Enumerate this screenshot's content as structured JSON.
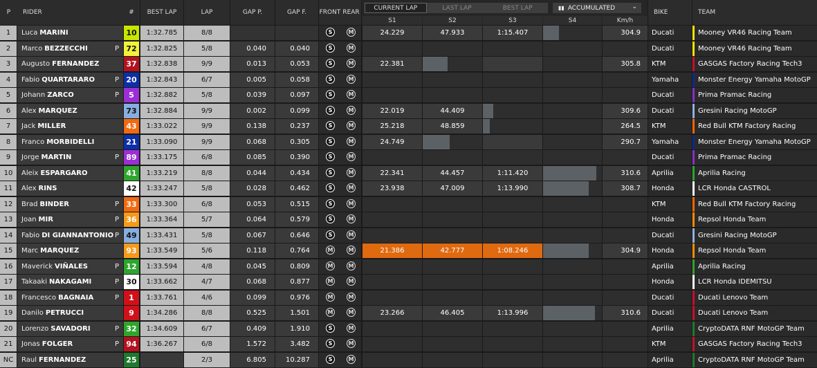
{
  "headers": {
    "p": "P",
    "rider": "RIDER",
    "num": "#",
    "best_lap": "BEST LAP",
    "lap": "LAP",
    "gap_p": "GAP P.",
    "gap_f": "GAP F.",
    "front": "FRONT",
    "rear": "REAR",
    "bike": "BIKE",
    "team": "TEAM"
  },
  "tabs": [
    "CURRENT LAP",
    "LAST LAP",
    "BEST LAP"
  ],
  "dropdown": {
    "value": "ACCUMULATED",
    "icon": "bar-chart-icon"
  },
  "sector_headers": [
    "S1",
    "S2",
    "S3",
    "S4",
    "Km/h"
  ],
  "colors": {
    "ducati_vr46": "#f2e500",
    "gasgas": "#c8102e",
    "yamaha": "#0a2a8c",
    "pramac": "#8b2fc9",
    "gresini": "#8fb4dc",
    "ktm": "#ff6600",
    "aprilia": "#2ea62e",
    "lcr": "#ffffff",
    "repsol": "#ff8c00",
    "lenovo": "#c8102e",
    "rnf": "#1f7a2e"
  },
  "riders": [
    {
      "pos": "1",
      "first": "Luca",
      "last": "MARINI",
      "pen": "",
      "num": "10",
      "num_bg": "#c8e600",
      "num_fg": "#111",
      "best": "1:32.785",
      "laps": "8/8",
      "gap_p": "",
      "gap_f": "",
      "front": "S",
      "rear": "M",
      "s1": "24.229",
      "s2": "47.933",
      "s3": "1:15.407",
      "s4_fill": 0.27,
      "s1o": false,
      "kmh": "304.9",
      "bike": "Ducati",
      "team": "Mooney VR46 Racing Team",
      "tcolor": "#f2e500"
    },
    {
      "pos": "2",
      "first": "Marco",
      "last": "BEZZECCHI",
      "pen": "P",
      "num": "72",
      "num_bg": "#f2f23a",
      "num_fg": "#111",
      "best": "1:32.825",
      "laps": "5/8",
      "gap_p": "0.040",
      "gap_f": "0.040",
      "front": "S",
      "rear": "M",
      "s1": "",
      "s2": "",
      "s3": "",
      "s4_fill": 0,
      "kmh": "",
      "bike": "Ducati",
      "team": "Mooney VR46 Racing Team",
      "tcolor": "#f2e500"
    },
    {
      "pos": "3",
      "first": "Augusto",
      "last": "FERNANDEZ",
      "pen": "",
      "num": "37",
      "num_bg": "#b3121f",
      "num_fg": "#fff",
      "best": "1:32.838",
      "laps": "9/9",
      "gap_p": "0.013",
      "gap_f": "0.053",
      "front": "S",
      "rear": "M",
      "s1": "22.381",
      "s2": "",
      "s3": "",
      "s2_fill": 0.42,
      "s4_fill": 0,
      "kmh": "305.8",
      "bike": "KTM",
      "team": "GASGAS Factory Racing Tech3",
      "tcolor": "#c8102e"
    },
    {
      "pos": "4",
      "first": "Fabio",
      "last": "QUARTARARO",
      "pen": "P",
      "num": "20",
      "num_bg": "#0d2fa8",
      "num_fg": "#fff",
      "best": "1:32.843",
      "laps": "6/7",
      "gap_p": "0.005",
      "gap_f": "0.058",
      "front": "S",
      "rear": "M",
      "s1": "",
      "s2": "",
      "s3": "",
      "s4_fill": 0,
      "kmh": "",
      "bike": "Yamaha",
      "team": "Monster Energy Yamaha MotoGP",
      "tcolor": "#0a2a8c"
    },
    {
      "pos": "5",
      "first": "Johann",
      "last": "ZARCO",
      "pen": "P",
      "num": "5",
      "num_bg": "#9b2fd6",
      "num_fg": "#fff",
      "best": "1:32.882",
      "laps": "5/8",
      "gap_p": "0.039",
      "gap_f": "0.097",
      "front": "S",
      "rear": "M",
      "s1": "",
      "s2": "",
      "s3": "",
      "s4_fill": 0,
      "kmh": "",
      "bike": "Ducati",
      "team": "Prima Pramac Racing",
      "tcolor": "#8b2fc9"
    },
    {
      "pos": "6",
      "first": "Alex",
      "last": "MARQUEZ",
      "pen": "",
      "num": "73",
      "num_bg": "#86aee0",
      "num_fg": "#111",
      "best": "1:32.884",
      "laps": "9/9",
      "gap_p": "0.002",
      "gap_f": "0.099",
      "front": "S",
      "rear": "M",
      "s1": "22.019",
      "s2": "44.409",
      "s3": "",
      "s3_fill": 0.17,
      "s4_fill": 0,
      "kmh": "309.6",
      "bike": "Ducati",
      "team": "Gresini Racing MotoGP",
      "tcolor": "#8fb4dc"
    },
    {
      "pos": "7",
      "first": "Jack",
      "last": "MILLER",
      "pen": "",
      "num": "43",
      "num_bg": "#f26a10",
      "num_fg": "#fff",
      "best": "1:33.022",
      "laps": "9/9",
      "gap_p": "0.138",
      "gap_f": "0.237",
      "front": "S",
      "rear": "M",
      "s1": "25.218",
      "s2": "48.859",
      "s3": "",
      "s3_fill": 0.12,
      "s4_fill": 0,
      "kmh": "264.5",
      "bike": "KTM",
      "team": "Red Bull KTM Factory Racing",
      "tcolor": "#ff6600"
    },
    {
      "pos": "8",
      "first": "Franco",
      "last": "MORBIDELLI",
      "pen": "",
      "num": "21",
      "num_bg": "#0d2fa8",
      "num_fg": "#fff",
      "best": "1:33.090",
      "laps": "9/9",
      "gap_p": "0.068",
      "gap_f": "0.305",
      "front": "S",
      "rear": "M",
      "s1": "24.749",
      "s2": "",
      "s3": "",
      "s2_fill": 0.45,
      "s4_fill": 0,
      "kmh": "290.7",
      "bike": "Yamaha",
      "team": "Monster Energy Yamaha MotoGP",
      "tcolor": "#0a2a8c"
    },
    {
      "pos": "9",
      "first": "Jorge",
      "last": "MARTIN",
      "pen": "P",
      "num": "89",
      "num_bg": "#9b2fd6",
      "num_fg": "#fff",
      "best": "1:33.175",
      "laps": "6/8",
      "gap_p": "0.085",
      "gap_f": "0.390",
      "front": "S",
      "rear": "M",
      "s1": "",
      "s2": "",
      "s3": "",
      "s4_fill": 0,
      "kmh": "",
      "bike": "Ducati",
      "team": "Prima Pramac Racing",
      "tcolor": "#8b2fc9"
    },
    {
      "pos": "10",
      "first": "Aleix",
      "last": "ESPARGARO",
      "pen": "",
      "num": "41",
      "num_bg": "#2ea62e",
      "num_fg": "#fff",
      "best": "1:33.219",
      "laps": "8/8",
      "gap_p": "0.044",
      "gap_f": "0.434",
      "front": "S",
      "rear": "M",
      "s1": "22.341",
      "s2": "44.457",
      "s3": "1:11.420",
      "s4_fill": 0.9,
      "kmh": "310.6",
      "bike": "Aprilia",
      "team": "Aprilia Racing",
      "tcolor": "#2ea62e"
    },
    {
      "pos": "11",
      "first": "Alex",
      "last": "RINS",
      "pen": "",
      "num": "42",
      "num_bg": "#ffffff",
      "num_fg": "#111",
      "best": "1:33.247",
      "laps": "5/8",
      "gap_p": "0.028",
      "gap_f": "0.462",
      "front": "S",
      "rear": "M",
      "s1": "23.938",
      "s2": "47.009",
      "s3": "1:13.990",
      "s4_fill": 0.78,
      "kmh": "308.7",
      "bike": "Honda",
      "team": "LCR Honda CASTROL",
      "tcolor": "#ffffff"
    },
    {
      "pos": "12",
      "first": "Brad",
      "last": "BINDER",
      "pen": "P",
      "num": "33",
      "num_bg": "#f26a10",
      "num_fg": "#fff",
      "best": "1:33.300",
      "laps": "6/8",
      "gap_p": "0.053",
      "gap_f": "0.515",
      "front": "S",
      "rear": "M",
      "s1": "",
      "s2": "",
      "s3": "",
      "s4_fill": 0,
      "kmh": "",
      "bike": "KTM",
      "team": "Red Bull KTM Factory Racing",
      "tcolor": "#ff6600"
    },
    {
      "pos": "13",
      "first": "Joan",
      "last": "MIR",
      "pen": "P",
      "num": "36",
      "num_bg": "#f59a1a",
      "num_fg": "#fff",
      "best": "1:33.364",
      "laps": "5/7",
      "gap_p": "0.064",
      "gap_f": "0.579",
      "front": "S",
      "rear": "M",
      "s1": "",
      "s2": "",
      "s3": "",
      "s4_fill": 0,
      "kmh": "",
      "bike": "Honda",
      "team": "Repsol Honda Team",
      "tcolor": "#ff8c00"
    },
    {
      "pos": "14",
      "first": "Fabio",
      "last": "DI GIANNANTONIO",
      "pen": "P",
      "num": "49",
      "num_bg": "#86aee0",
      "num_fg": "#111",
      "best": "1:33.431",
      "laps": "5/8",
      "gap_p": "0.067",
      "gap_f": "0.646",
      "front": "S",
      "rear": "M",
      "s1": "",
      "s2": "",
      "s3": "",
      "s4_fill": 0,
      "kmh": "",
      "bike": "Ducati",
      "team": "Gresini Racing MotoGP",
      "tcolor": "#8fb4dc"
    },
    {
      "pos": "15",
      "first": "Marc",
      "last": "MARQUEZ",
      "pen": "",
      "num": "93",
      "num_bg": "#f59a1a",
      "num_fg": "#fff",
      "best": "1:33.549",
      "laps": "5/6",
      "gap_p": "0.118",
      "gap_f": "0.764",
      "front": "M",
      "rear": "M",
      "s1": "21.386",
      "s2": "42.777",
      "s3": "1:08.246",
      "s4_fill": 0.78,
      "orange": true,
      "kmh": "304.9",
      "bike": "Honda",
      "team": "Repsol Honda Team",
      "tcolor": "#ff8c00"
    },
    {
      "pos": "16",
      "first": "Maverick",
      "last": "VIÑALES",
      "pen": "P",
      "num": "12",
      "num_bg": "#2ea62e",
      "num_fg": "#fff",
      "best": "1:33.594",
      "laps": "4/8",
      "gap_p": "0.045",
      "gap_f": "0.809",
      "front": "M",
      "rear": "M",
      "s1": "",
      "s2": "",
      "s3": "",
      "s4_fill": 0,
      "kmh": "",
      "bike": "Aprilia",
      "team": "Aprilia Racing",
      "tcolor": "#2ea62e"
    },
    {
      "pos": "17",
      "first": "Takaaki",
      "last": "NAKAGAMI",
      "pen": "P",
      "num": "30",
      "num_bg": "#ffffff",
      "num_fg": "#111",
      "best": "1:33.662",
      "laps": "4/7",
      "gap_p": "0.068",
      "gap_f": "0.877",
      "front": "M",
      "rear": "M",
      "s1": "",
      "s2": "",
      "s3": "",
      "s4_fill": 0,
      "kmh": "",
      "bike": "Honda",
      "team": "LCR Honda IDEMITSU",
      "tcolor": "#ffffff"
    },
    {
      "pos": "18",
      "first": "Francesco",
      "last": "BAGNAIA",
      "pen": "P",
      "num": "1",
      "num_bg": "#d0101a",
      "num_fg": "#fff",
      "best": "1:33.761",
      "laps": "4/6",
      "gap_p": "0.099",
      "gap_f": "0.976",
      "front": "M",
      "rear": "M",
      "s1": "",
      "s2": "",
      "s3": "",
      "s4_fill": 0,
      "kmh": "",
      "bike": "Ducati",
      "team": "Ducati Lenovo Team",
      "tcolor": "#c8102e"
    },
    {
      "pos": "19",
      "first": "Danilo",
      "last": "PETRUCCI",
      "pen": "",
      "num": "9",
      "num_bg": "#d0101a",
      "num_fg": "#fff",
      "best": "1:34.286",
      "laps": "8/8",
      "gap_p": "0.525",
      "gap_f": "1.501",
      "front": "M",
      "rear": "M",
      "s1": "23.266",
      "s2": "46.405",
      "s3": "1:13.996",
      "s4_fill": 0.88,
      "kmh": "310.6",
      "bike": "Ducati",
      "team": "Ducati Lenovo Team",
      "tcolor": "#c8102e"
    },
    {
      "pos": "20",
      "first": "Lorenzo",
      "last": "SAVADORI",
      "pen": "P",
      "num": "32",
      "num_bg": "#2ea62e",
      "num_fg": "#fff",
      "best": "1:34.609",
      "laps": "6/7",
      "gap_p": "0.409",
      "gap_f": "1.910",
      "front": "S",
      "rear": "M",
      "s1": "",
      "s2": "",
      "s3": "",
      "s4_fill": 0,
      "kmh": "",
      "bike": "Aprilia",
      "team": "CryptoDATA RNF MotoGP Team",
      "tcolor": "#1f7a2e"
    },
    {
      "pos": "21",
      "first": "Jonas",
      "last": "FOLGER",
      "pen": "P",
      "num": "94",
      "num_bg": "#b3121f",
      "num_fg": "#fff",
      "best": "1:36.267",
      "laps": "6/8",
      "gap_p": "1.572",
      "gap_f": "3.482",
      "front": "S",
      "rear": "M",
      "s1": "",
      "s2": "",
      "s3": "",
      "s4_fill": 0,
      "kmh": "",
      "bike": "KTM",
      "team": "GASGAS Factory Racing Tech3",
      "tcolor": "#c8102e"
    },
    {
      "pos": "NC",
      "first": "Raul",
      "last": "FERNANDEZ",
      "pen": "",
      "num": "25",
      "num_bg": "#1f7a2e",
      "num_fg": "#fff",
      "best": "",
      "laps": "2/3",
      "gap_p": "6.805",
      "gap_f": "10.287",
      "front": "S",
      "rear": "M",
      "s1": "",
      "s2": "",
      "s3": "",
      "s4_fill": 0,
      "kmh": "",
      "bike": "Aprilia",
      "team": "CryptoDATA RNF MotoGP Team",
      "tcolor": "#1f7a2e"
    }
  ]
}
